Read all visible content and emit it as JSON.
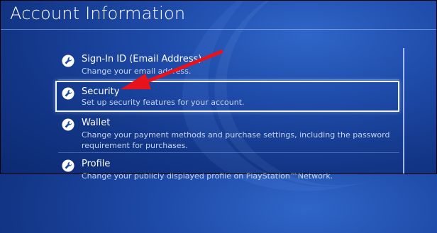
{
  "page": {
    "title": "Account Information"
  },
  "menu": {
    "items": [
      {
        "label": "Sign-In ID (Email Address)",
        "description": "Change your email address."
      },
      {
        "label": "Security",
        "description": "Set up security features for your account."
      },
      {
        "label": "Wallet",
        "description": "Change your payment methods and purchase settings, including the password requirement for purchases."
      },
      {
        "label": "Profile",
        "description": "Change your publicly displayed profile on PlayStation™Network."
      }
    ],
    "selected": "Security"
  },
  "colors": {
    "background": "#1e4aa8",
    "highlight_border": "#eef4ff",
    "annotation_arrow": "#e8121b"
  },
  "icons": {
    "item_icon": "wrench-icon"
  }
}
